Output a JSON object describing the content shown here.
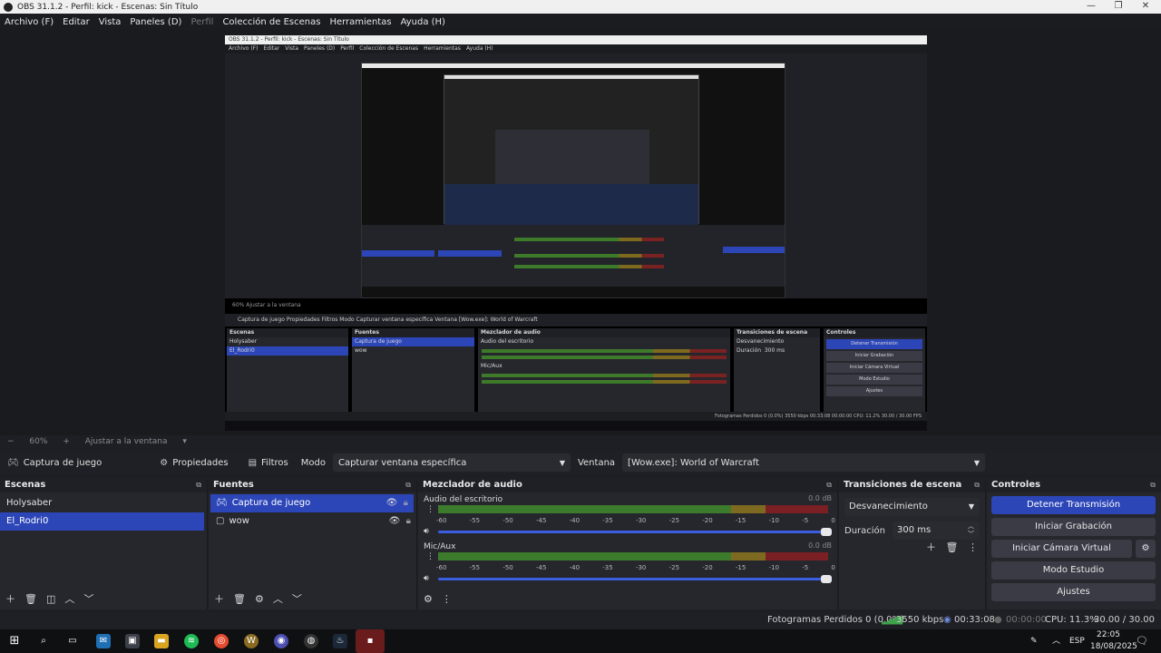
{
  "window": {
    "title": "OBS 31.1.2 - Perfil: kick - Escenas: Sin Título"
  },
  "menu": {
    "items": [
      "Archivo (F)",
      "Editar",
      "Vista",
      "Paneles (D)",
      "Perfil",
      "Colección de Escenas",
      "Herramientas",
      "Ayuda (H)"
    ]
  },
  "zoom": {
    "minus": "−",
    "value": "60%",
    "plus": "+",
    "fit": "Ajustar a la ventana"
  },
  "sourcebar": {
    "source": "Captura de juego",
    "properties": "Propiedades",
    "filters": "Filtros",
    "mode_label": "Modo",
    "mode_value": "Capturar ventana específica",
    "window_label": "Ventana",
    "window_value": "[Wow.exe]: World of Warcraft"
  },
  "scenes": {
    "title": "Escenas",
    "items": [
      "Holysaber",
      "El_Rodri0"
    ],
    "selected": "El_Rodri0"
  },
  "sources": {
    "title": "Fuentes",
    "items": [
      "Captura de juego",
      "wow"
    ]
  },
  "mixer": {
    "title": "Mezclador de audio",
    "channels": [
      {
        "name": "Audio del escritorio",
        "db": "0.0 dB"
      },
      {
        "name": "Mic/Aux",
        "db": "0.0 dB"
      }
    ],
    "ticks": [
      "-60",
      "-55",
      "-50",
      "-45",
      "-40",
      "-35",
      "-30",
      "-25",
      "-20",
      "-15",
      "-10",
      "-5",
      "0"
    ]
  },
  "transitions": {
    "title": "Transiciones de escena",
    "type": "Desvanecimiento",
    "duration_label": "Duración",
    "duration_value": "300 ms"
  },
  "controls": {
    "title": "Controles",
    "stop_stream": "Detener Transmisión",
    "start_record": "Iniciar Grabación",
    "virtual_cam": "Iniciar Cámara Virtual",
    "studio_mode": "Modo Estudio",
    "settings": "Ajustes"
  },
  "status": {
    "dropped": "Fotogramas Perdidos 0 (0.0%)",
    "bitrate": "3550 kbps",
    "stream_time": "00:33:08",
    "rec_time": "00:00:00",
    "cpu": "CPU: 11.3%",
    "fps": "30.00 / 30.00 FPS"
  },
  "taskbar": {
    "lang": "ESP",
    "time": "22:05",
    "date": "18/08/2025"
  },
  "preview": {
    "title": "OBS 31.1.2 - Perfil: kick - Escenas: Sin Título",
    "zoom": "60%     Ajustar a la ventana",
    "props": "Captura de juego     Propiedades     Filtros     Modo   Capturar ventana específica          Ventana   [Wow.exe]: World of Warcraft",
    "status": "Fotogramas Perdidos 0 (0.0%)     3550 kbps     00:33:08     00:00:00     CPU: 11.2%     30.00 / 30.00 FPS"
  },
  "colors": {
    "accent": "#2c46b8",
    "meter_green": "#3c7a2c",
    "meter_yellow": "#7d6a20",
    "meter_red": "#7a1f23"
  }
}
